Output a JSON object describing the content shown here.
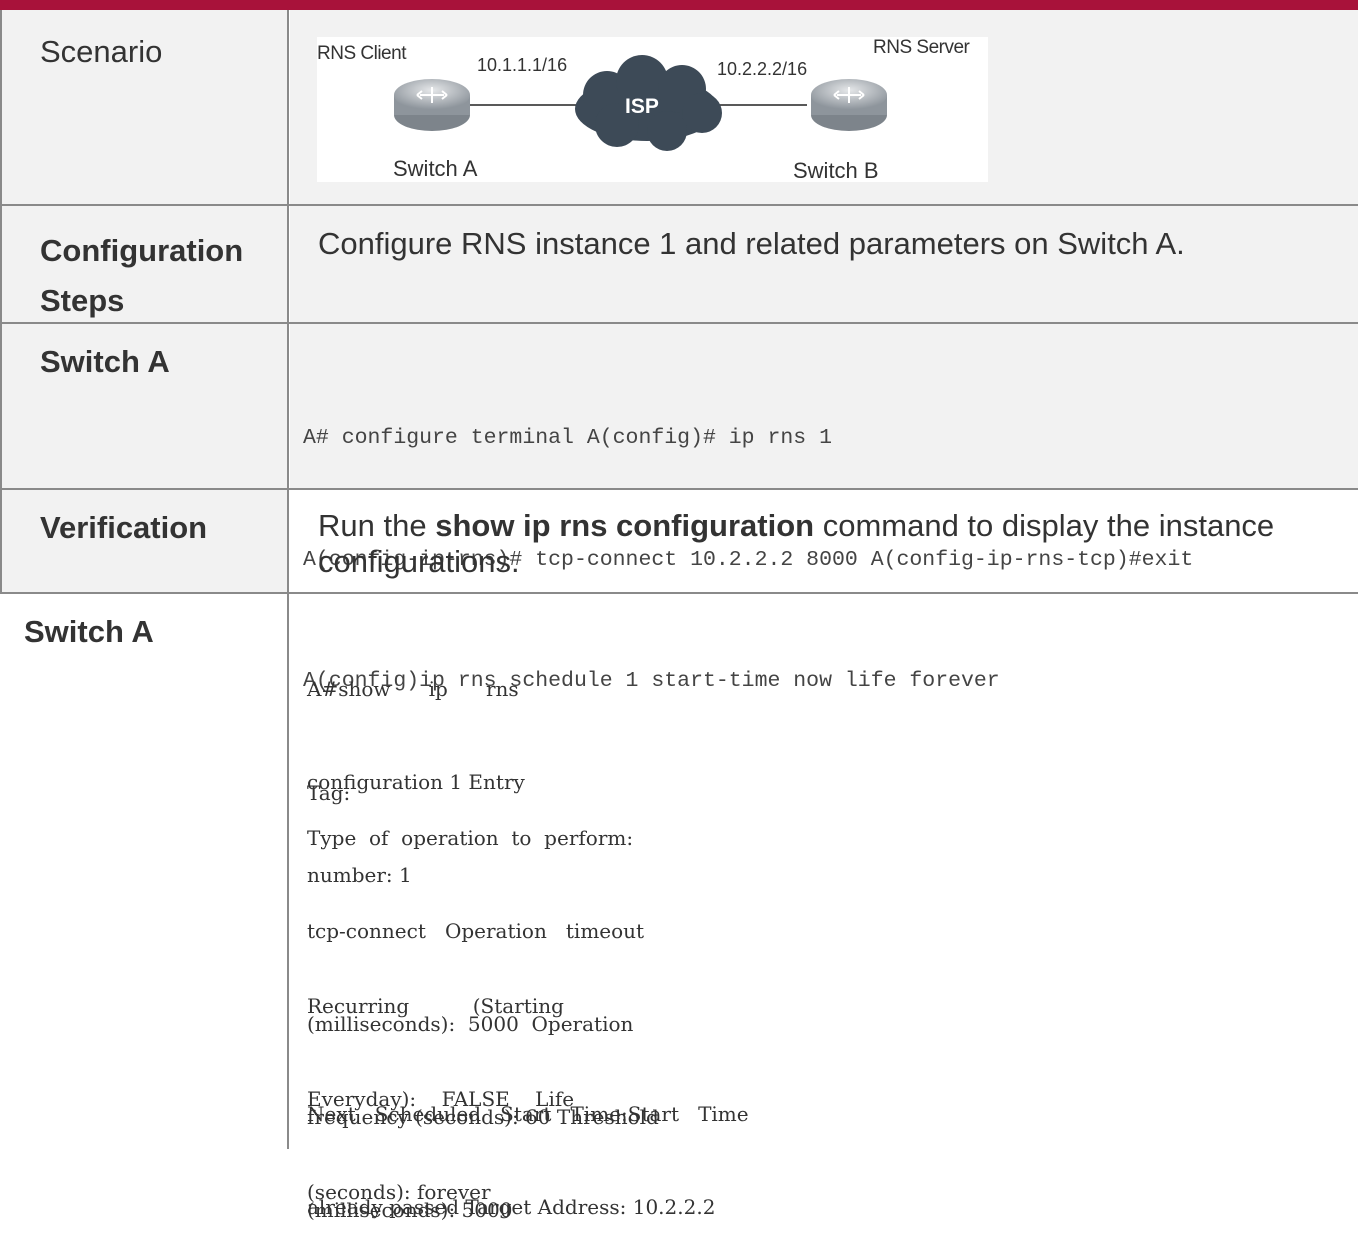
{
  "rows": {
    "scenario": {
      "label": "Scenario",
      "diagram": {
        "client_label": "RNS Client",
        "server_label": "RNS Server",
        "client_ip": "10.1.1.1/16",
        "server_ip": "10.2.2.2/16",
        "isp_label": "ISP",
        "switch_a_label": "Switch A",
        "switch_b_label": "Switch B"
      }
    },
    "config_steps": {
      "label_line1": "Configuration",
      "label_line2": "Steps",
      "text": "Configure RNS instance 1 and related parameters on Switch A."
    },
    "switch_a_config": {
      "label": "Switch A",
      "code_lines": [
        "A# configure terminal A(config)# ip rns 1",
        "A(config-ip-rns)# tcp-connect 10.2.2.2 8000 A(config-ip-rns-tcp)#exit",
        "A(config)ip rns schedule 1 start-time now life forever"
      ]
    },
    "verification": {
      "label": "Verification",
      "text_before": "Run the ",
      "command": "show ip rns configuration",
      "text_after": " command to display the instance",
      "text_line2": "configurations."
    },
    "switch_a_output": {
      "label": "Switch A",
      "output_blocks": [
        [
          "A#show      ip      rns",
          "configuration 1 Entry",
          "number: 1"
        ],
        [
          "Tag:"
        ],
        [
          "Type  of  operation  to  perform:",
          "tcp-connect   Operation   timeout",
          "(milliseconds):  5000  Operation",
          "frequency (seconds): 60 Threshold",
          "(milliseconds): 5000"
        ],
        [
          "Recurring          (Starting",
          "Everyday):    FALSE    Life",
          "(seconds): forever"
        ],
        [
          "Next   Scheduled   Start   Time:Start   Time",
          "already passed Target Address: 10.2.2.2"
        ]
      ]
    }
  },
  "colors": {
    "top_bar": "#a8123a",
    "label_cell_bg": "#f2f2f2",
    "border": "#8a8a8a",
    "router": "#9aa0a6",
    "cloud": "#3d4a57"
  },
  "icons": [
    "router-icon",
    "cloud-icon"
  ]
}
